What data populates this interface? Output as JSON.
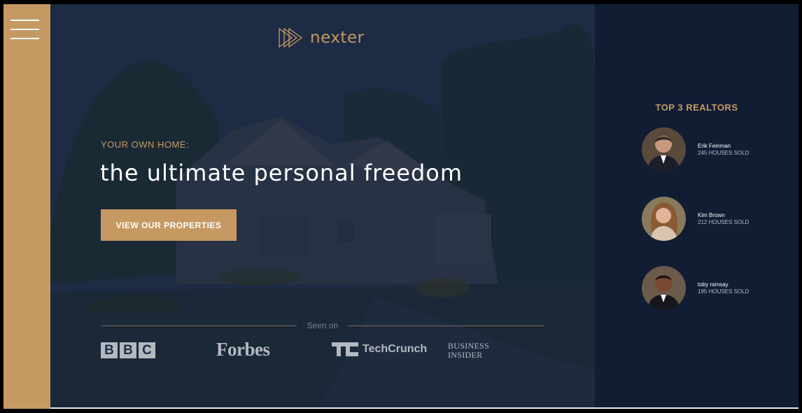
{
  "sidebar": {
    "menu_icon": "hamburger-menu-icon"
  },
  "header": {
    "logo_text": "nexter",
    "logo_icon": "triangle-arrows-icon"
  },
  "hero": {
    "eyebrow": "YOUR OWN HOME:",
    "headline": "the ultimate personal freedom",
    "cta_label": "VIEW OUR PROPERTIES"
  },
  "seen_on": {
    "label": "Seen on",
    "brands": {
      "bbc": [
        "B",
        "B",
        "C"
      ],
      "forbes": "Forbes",
      "techcrunch": "TechCrunch",
      "business_insider_line1": "BUSINESS",
      "business_insider_line2": "INSIDER"
    }
  },
  "realtors": {
    "title": "TOP 3 REALTORS",
    "items": [
      {
        "name": "Erik Feinman",
        "sold": "245 HOUSES SOLD"
      },
      {
        "name": "Kim Brown",
        "sold": "212 HOUSES SOLD"
      },
      {
        "name": "toby ramsay",
        "sold": "195 HOUSES SOLD"
      }
    ]
  },
  "colors": {
    "accent": "#c69963",
    "dark_navy": "#101d33",
    "hero_overlay": "#1e2c45",
    "white": "#ffffff"
  }
}
